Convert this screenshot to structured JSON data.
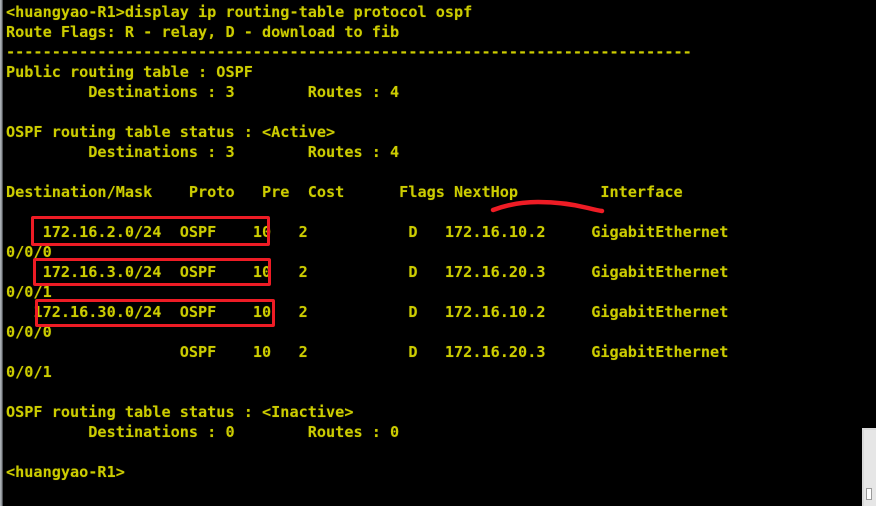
{
  "terminal": {
    "prompt_host": "<huangyao-R1>",
    "command": "display ip routing-table protocol ospf",
    "foreground_color": "#cccc00",
    "background_color": "#000000",
    "annotation_color": "#ee1c25",
    "lines": [
      "<huangyao-R1>display ip routing-table protocol ospf",
      "Route Flags: R - relay, D - download to fib",
      "---------------------------------------------------------------------------",
      "Public routing table : OSPF",
      "         Destinations : 3        Routes : 4",
      "",
      "OSPF routing table status : <Active>",
      "         Destinations : 3        Routes : 4",
      "",
      "Destination/Mask    Proto   Pre  Cost      Flags NextHop         Interface",
      "",
      "    172.16.2.0/24  OSPF    10   2           D   172.16.10.2     GigabitEthernet",
      "0/0/0",
      "    172.16.3.0/24  OSPF    10   2           D   172.16.20.3     GigabitEthernet",
      "0/0/1",
      "   172.16.30.0/24  OSPF    10   2           D   172.16.10.2     GigabitEthernet",
      "0/0/0",
      "                   OSPF    10   2           D   172.16.20.3     GigabitEthernet",
      "0/0/1",
      "",
      "OSPF routing table status : <Inactive>",
      "         Destinations : 0        Routes : 0",
      "",
      "<huangyao-R1>"
    ]
  },
  "route_flags_legend": {
    "text": "Route Flags: R - relay, D - download to fib",
    "relay": "R - relay",
    "download": "D - download to fib"
  },
  "public_table": {
    "title": "Public routing table : OSPF",
    "destinations_label": "Destinations",
    "destinations": "3",
    "routes_label": "Routes",
    "routes": "4"
  },
  "active_table": {
    "title": "OSPF routing table status : <Active>",
    "status": "<Active>",
    "destinations_label": "Destinations",
    "destinations": "3",
    "routes_label": "Routes",
    "routes": "4"
  },
  "inactive_table": {
    "title": "OSPF routing table status : <Inactive>",
    "status": "<Inactive>",
    "destinations_label": "Destinations",
    "destinations": "0",
    "routes_label": "Routes",
    "routes": "0"
  },
  "routing_table": {
    "headers": [
      "Destination/Mask",
      "Proto",
      "Pre",
      "Cost",
      "Flags",
      "NextHop",
      "Interface"
    ],
    "rows": [
      {
        "destination": "172.16.2.0/24",
        "proto": "OSPF",
        "pre": "10",
        "cost": "2",
        "flags": "D",
        "nexthop": "172.16.10.2",
        "interface": "GigabitEthernet",
        "interface_cont": "0/0/0",
        "highlighted": true
      },
      {
        "destination": "172.16.3.0/24",
        "proto": "OSPF",
        "pre": "10",
        "cost": "2",
        "flags": "D",
        "nexthop": "172.16.20.3",
        "interface": "GigabitEthernet",
        "interface_cont": "0/0/1",
        "highlighted": true
      },
      {
        "destination": "172.16.30.0/24",
        "proto": "OSPF",
        "pre": "10",
        "cost": "2",
        "flags": "D",
        "nexthop": "172.16.10.2",
        "interface": "GigabitEthernet",
        "interface_cont": "0/0/0",
        "highlighted": true
      },
      {
        "destination": "",
        "proto": "OSPF",
        "pre": "10",
        "cost": "2",
        "flags": "D",
        "nexthop": "172.16.20.3",
        "interface": "GigabitEthernet",
        "interface_cont": "0/0/1",
        "highlighted": false
      }
    ]
  },
  "annotations": {
    "boxes": [
      {
        "name": "route-1-highlight",
        "target": "172.16.2.0/24  OSPF"
      },
      {
        "name": "route-2-highlight",
        "target": "172.16.3.0/24  OSPF"
      },
      {
        "name": "route-3-highlight",
        "target": "172.16.30.0/24  OSPF"
      }
    ],
    "underline": {
      "name": "nexthop-underline",
      "target": "NextHop"
    }
  }
}
